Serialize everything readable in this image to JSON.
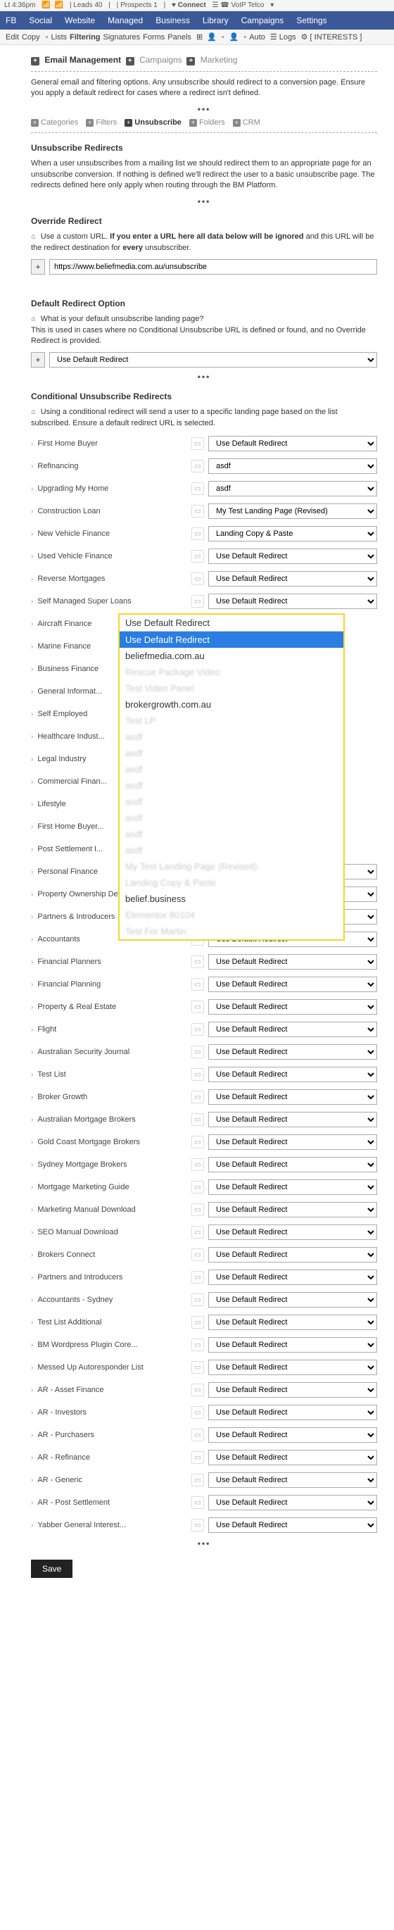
{
  "topbar": {
    "time": "Lt 4:36pm",
    "leads": "Leads 40",
    "prospects": "Prospects 1",
    "connect": "Connect",
    "voip": "VoIP Telco"
  },
  "mainnav": [
    "FB",
    "Social",
    "Website",
    "Managed",
    "Business",
    "Library",
    "Campaigns",
    "Settings"
  ],
  "subnav": {
    "left": [
      "Edit",
      "Copy",
      "Lists",
      "Filtering",
      "Signatures",
      "Forms",
      "Panels"
    ],
    "mid_auto": "Auto",
    "mid_logs": "Logs",
    "interests": "[ INTERESTS ]"
  },
  "breadcrumb": {
    "a": "Email Management",
    "b": "Campaigns",
    "c": "Marketing"
  },
  "intro": "General email and filtering options. Any unsubscribe should redirect to a conversion page. Ensure you apply a default redirect for cases where a redirect isn't defined.",
  "tabs": [
    "Categories",
    "Filters",
    "Unsubscribe",
    "Folders",
    "CRM"
  ],
  "sections": {
    "unsub_redirects": {
      "title": "Unsubscribe Redirects",
      "body": "When a user unsubscribes from a mailing list we should redirect them to an appropriate page for an unsubscribe conversion. If nothing is defined we'll redirect the user to a basic unsubscribe page. The redirects defined here only apply when routing through the BM Platform."
    },
    "override": {
      "title": "Override Redirect",
      "hint_a": "Use a custom URL.",
      "hint_b": "If you enter a URL here all data below will be ignored",
      "hint_c": "and this URL will be the redirect destination for",
      "hint_d": "every",
      "hint_e": "unsubscriber.",
      "value": "https://www.beliefmedia.com.au/unsubscribe"
    },
    "default_redirect": {
      "title": "Default Redirect Option",
      "line1": "What is your default unsubscribe landing page?",
      "line2": "This is used in cases where no Conditional Unsubscribe URL is defined or found, and no Override Redirect is provided.",
      "selected": "Use Default Redirect"
    },
    "conditional": {
      "title": "Conditional Unsubscribe Redirects",
      "hint": "Using a conditional redirect will send a user to a specific landing page based on the list subscribed. Ensure a default redirect URL is selected."
    }
  },
  "default_sel": "Use Default Redirect",
  "asdf": "asdf",
  "landing_revised": "My Test Landing Page (Revised)",
  "landing_copy": "Landing Copy & Paste",
  "cond_rows_top": [
    {
      "label": "First Home Buyer",
      "sel": "Use Default Redirect"
    },
    {
      "label": "Refinancing",
      "sel": "asdf"
    },
    {
      "label": "Upgrading My Home",
      "sel": "asdf"
    },
    {
      "label": "Construction Loan",
      "sel": "My Test Landing Page (Revised)"
    },
    {
      "label": "New Vehicle Finance",
      "sel": "Landing Copy & Paste"
    },
    {
      "label": "Used Vehicle Finance",
      "sel": "Use Default Redirect"
    },
    {
      "label": "Reverse Mortgages",
      "sel": "Use Default Redirect"
    },
    {
      "label": "Self Managed Super Loans",
      "sel": "Use Default Redirect"
    }
  ],
  "overlay_labels": [
    "Aircraft Finance",
    "Marine Finance",
    "Business Finance",
    "General Informat...",
    "Self Employed",
    "Healthcare Indust...",
    "Legal Industry",
    "Commercial Finan...",
    "Lifestyle",
    "First Home Buyer...",
    "Post Settlement I..."
  ],
  "dropdown": {
    "header": "Use Default Redirect",
    "selected": "Use Default Redirect",
    "domain1": "beliefmedia.com.au",
    "domain2": "brokergrowth.com.au",
    "domain3": "belief.business"
  },
  "cond_rows_bottom": [
    "Personal Finance",
    "Property Ownership Development...",
    "Partners & Introducers",
    "Accountants",
    "Financial Planners",
    "Financial Planning",
    "Property & Real Estate",
    "Flight",
    "Australian Security Journal",
    "Test List",
    "Broker Growth",
    "Australian Mortgage Brokers",
    "Gold Coast Mortgage Brokers",
    "Sydney Mortgage Brokers",
    "Mortgage Marketing Guide",
    "Marketing Manual Download",
    "SEO Manual Download",
    "Brokers Connect",
    "Partners and Introducers",
    "Accountants - Sydney",
    "Test List Additional",
    "BM Wordpress Plugin Core...",
    "Messed Up Autoresponder List",
    "AR - Asset Finance",
    "AR - Investors",
    "AR - Purchasers",
    "AR - Refinance",
    "AR - Generic",
    "AR - Post Settlement",
    "Yabber General Interest..."
  ],
  "save": "Save"
}
